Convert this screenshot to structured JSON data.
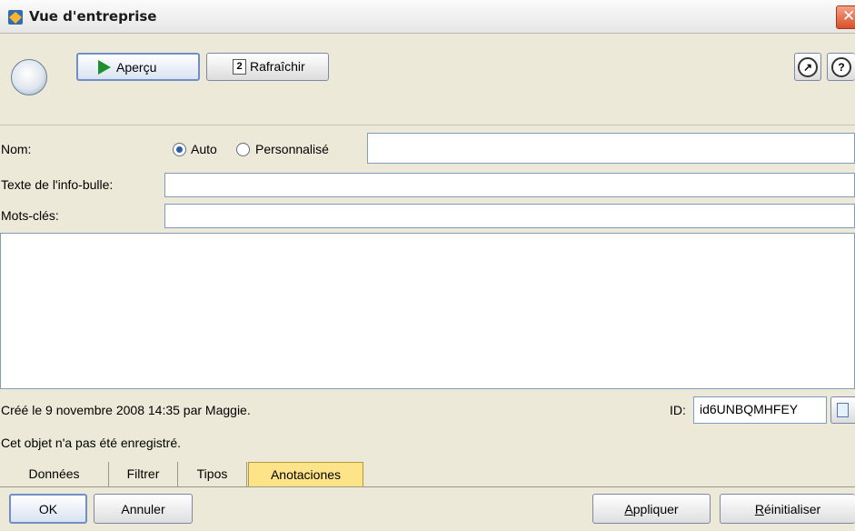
{
  "window": {
    "title": "Vue d'entreprise",
    "close_glyph": "✕"
  },
  "toolbar": {
    "preview_label": "Aperçu",
    "refresh_label": "Rafraîchir",
    "refresh_glyph": "2",
    "launch_glyph": "↗",
    "help_glyph": "?"
  },
  "form": {
    "name_label": "Nom:",
    "auto_label": "Auto",
    "custom_label": "Personnalisé",
    "name_value": "",
    "tooltip_label": "Texte de l'info-bulle:",
    "tooltip_value": "",
    "keywords_label": "Mots-clés:",
    "keywords_value": "",
    "annotation_text": ""
  },
  "meta": {
    "created": "Créé le 9 novembre 2008 14:35 par Maggie.",
    "id_label": "ID:",
    "id_value": "id6UNBQMHFEY",
    "save_status": "Cet objet n'a pas été enregistré."
  },
  "tabs": [
    "Données",
    "Filtrer",
    "Tipos",
    "Anotaciones"
  ],
  "active_tab": "Anotaciones",
  "footer": {
    "ok": "OK",
    "cancel": "Annuler",
    "apply_u": "A",
    "apply_rest": "ppliquer",
    "reset_u": "R",
    "reset_rest": "éinitialiser"
  },
  "colors": {
    "active_tab": "#ffe389",
    "accent": "#6f8fc6",
    "close": "#d8502a"
  }
}
